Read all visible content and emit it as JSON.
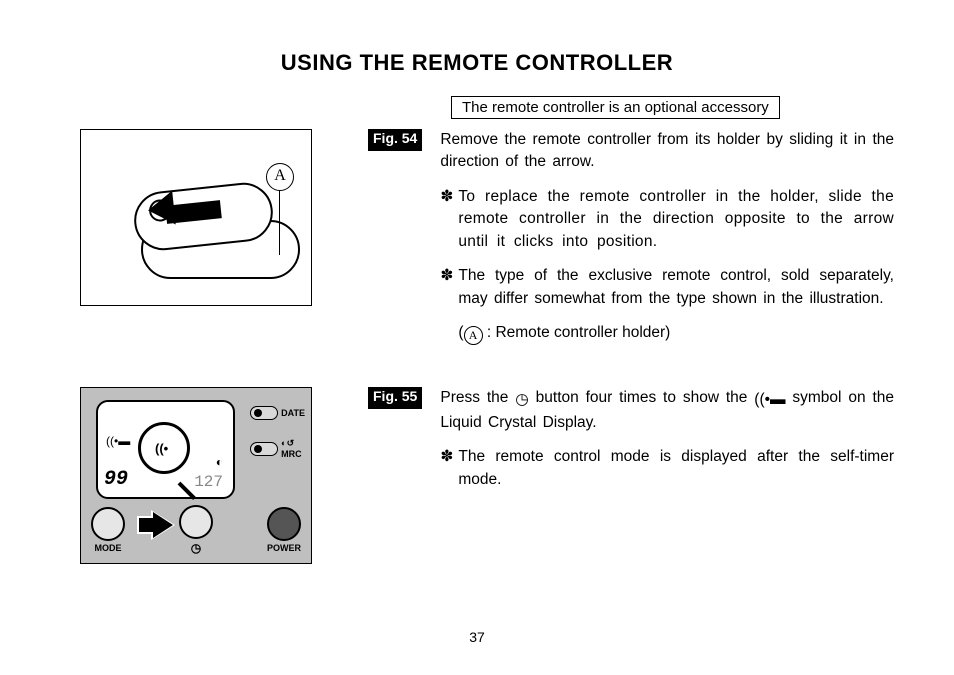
{
  "title": "USING THE REMOTE CONTROLLER",
  "subtitle": "The remote controller is an optional accessory",
  "fig54": {
    "label": "Fig. 54",
    "callout": "A",
    "p1": "Remove the remote controller from its holder by sliding it in the direction of the arrow.",
    "b1": "To replace the remote controller in the holder, slide the remote controller in the direction opposite to the arrow until it clicks into position.",
    "b2": "The type of the exclusive remote control, sold separately, may differ somewhat from the type shown in the illustration.",
    "b2_sub_after": " : Remote controller holder)"
  },
  "fig55": {
    "label": "Fig. 55",
    "p1_a": "Press the ",
    "p1_b": " button four times to show the ",
    "p1_c": " symbol on the Liquid Crystal Display.",
    "b1": "The remote control mode is displayed after the self-timer mode.",
    "lcd_seg": "99",
    "lcd_right": "127",
    "date_label": "DATE",
    "mrc_label": "MRC",
    "mode_label": "MODE",
    "power_label": "POWER"
  },
  "page_number": "37"
}
